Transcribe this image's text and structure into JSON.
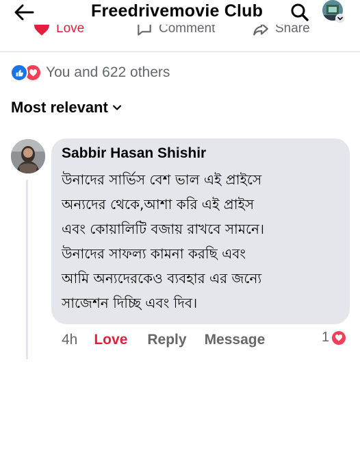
{
  "header": {
    "back_icon": "arrow-left-icon",
    "title": "Freedrivemovie Club",
    "search_icon": "search-icon",
    "profile_icon": "profile-avatar"
  },
  "post_actions": {
    "love_label": "Love",
    "comment_label": "Comment",
    "share_label": "Share",
    "love_color": "#e41e3f"
  },
  "reactions": {
    "icons": [
      "like-icon",
      "love-icon"
    ],
    "summary": "You and 622 others"
  },
  "sort": {
    "label": "Most relevant"
  },
  "comment": {
    "author": "Sabbir Hasan Shishir",
    "text": "উনাদের সার্ভিস বেশ ভাল এই প্রাইসে\nঅন্যদের থেকে,আশা করি এই প্রাইস\nএবং কোয়ালিটি বজায় রাখবে সামনে।\nউনাদের সাফল্য কামনা করছি এবং\nআমি অন্যদেরকেও ব্যবহার এর জন্যে\nসাজেশন দিচ্ছি এবং দিব।",
    "time": "4h",
    "love_label": "Love",
    "reply_label": "Reply",
    "message_label": "Message",
    "reaction_count": "1",
    "reaction_icon": "love-icon"
  }
}
